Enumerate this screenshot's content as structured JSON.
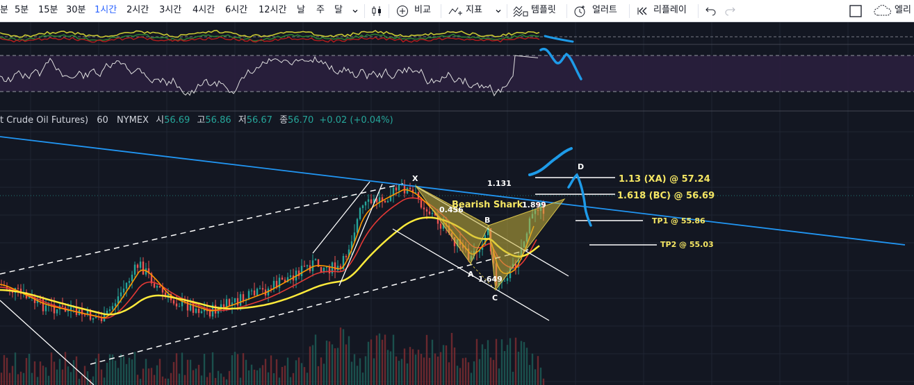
{
  "toolbar": {
    "intervals": [
      "분",
      "5분",
      "15분",
      "30분",
      "1시간",
      "2시간",
      "3시간",
      "4시간",
      "6시간",
      "12시간",
      "날",
      "주",
      "달"
    ],
    "active_interval": "1시간",
    "compare_label": "비교",
    "indicators_label": "지표",
    "templates_label": "템플릿",
    "alert_label": "얼러트",
    "replay_label": "리플레이",
    "right_label": "엘리"
  },
  "legend": {
    "symbol": "t Crude Oil Futures)",
    "interval": "60",
    "exchange": "NYMEX",
    "open_label": "시",
    "open": "56.69",
    "high_label": "고",
    "high": "56.86",
    "low_label": "저",
    "low": "56.67",
    "close_label": "종",
    "close": "56.70",
    "change": "+0.02 (+0.04%)"
  },
  "pattern": {
    "name": "Bearish Shark",
    "points": {
      "x": "X",
      "a": "A",
      "b": "B",
      "c": "C",
      "d": "D"
    },
    "ratios": {
      "ab": "0.456",
      "bc": "1.649",
      "xa": "1.131",
      "cd": "1.899"
    },
    "targets": [
      {
        "label": "1.13 (XA) @ 57.24",
        "color": "#f5e663"
      },
      {
        "label": "1.618 (BC) @ 56.69",
        "color": "#f5e663"
      },
      {
        "label": "TP1 @ 55.86",
        "color": "#f5e663"
      },
      {
        "label": "TP2 @ 55.03",
        "color": "#f5e663"
      }
    ]
  },
  "colors": {
    "background": "#131722",
    "trendline": "#2196f3",
    "pattern_fill": "#c8b43c",
    "ma_yellow": "#ffeb3b",
    "ma_orange": "#ff9800",
    "ma_red": "#e53935",
    "annotation_blue": "#1e9be8"
  }
}
